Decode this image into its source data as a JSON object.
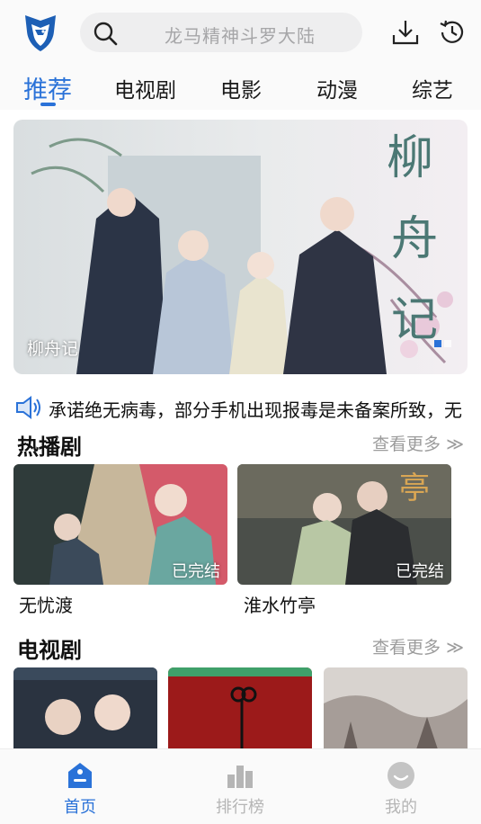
{
  "search": {
    "placeholder": "龙马精神斗罗大陆"
  },
  "tabs": [
    {
      "label": "推荐",
      "active": true
    },
    {
      "label": "电视剧"
    },
    {
      "label": "电影"
    },
    {
      "label": "动漫"
    },
    {
      "label": "综艺"
    }
  ],
  "banner": {
    "title": "柳舟记",
    "page_count": 2,
    "active_page": 1
  },
  "notice": {
    "text": "承诺绝无病毒，部分手机出现报毒是未备案所致，无"
  },
  "hot": {
    "title": "热播剧",
    "more": "查看更多",
    "items": [
      {
        "title": "无忧渡",
        "badge": "已完结"
      },
      {
        "title": "淮水竹亭",
        "badge": "已完结"
      }
    ]
  },
  "tv": {
    "title": "电视剧",
    "more": "查看更多"
  },
  "bottom_nav": [
    {
      "label": "首页",
      "icon": "home-icon",
      "active": true
    },
    {
      "label": "排行榜",
      "icon": "ranking-icon"
    },
    {
      "label": "我的",
      "icon": "profile-icon"
    }
  ],
  "colors": {
    "accent": "#2a72d8",
    "muted": "#b5b5b5"
  }
}
